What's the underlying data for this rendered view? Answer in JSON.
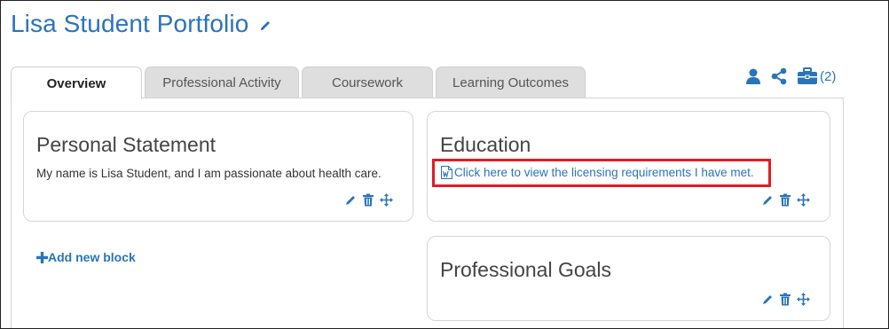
{
  "page": {
    "title": "Lisa Student Portfolio"
  },
  "tabs": [
    {
      "label": "Overview",
      "active": true
    },
    {
      "label": "Professional Activity",
      "active": false
    },
    {
      "label": "Coursework",
      "active": false
    },
    {
      "label": "Learning Outcomes",
      "active": false
    }
  ],
  "toolbar": {
    "share_count": "(2)"
  },
  "blocks": {
    "personal": {
      "title": "Personal Statement",
      "text": "My name is Lisa Student, and I am passionate about health care."
    },
    "education": {
      "title": "Education",
      "link": "Click here to view the licensing requirements I have met."
    },
    "goals": {
      "title": "Professional Goals"
    }
  },
  "add_block": {
    "label": "Add new block"
  },
  "colors": {
    "accent": "#2a74b9",
    "highlight": "#e31b23",
    "tab_inactive": "#dedede"
  },
  "icons": [
    "pencil-icon",
    "user-icon",
    "share-icon",
    "briefcase-icon",
    "trash-icon",
    "move-icon",
    "document-icon",
    "plus-icon"
  ]
}
